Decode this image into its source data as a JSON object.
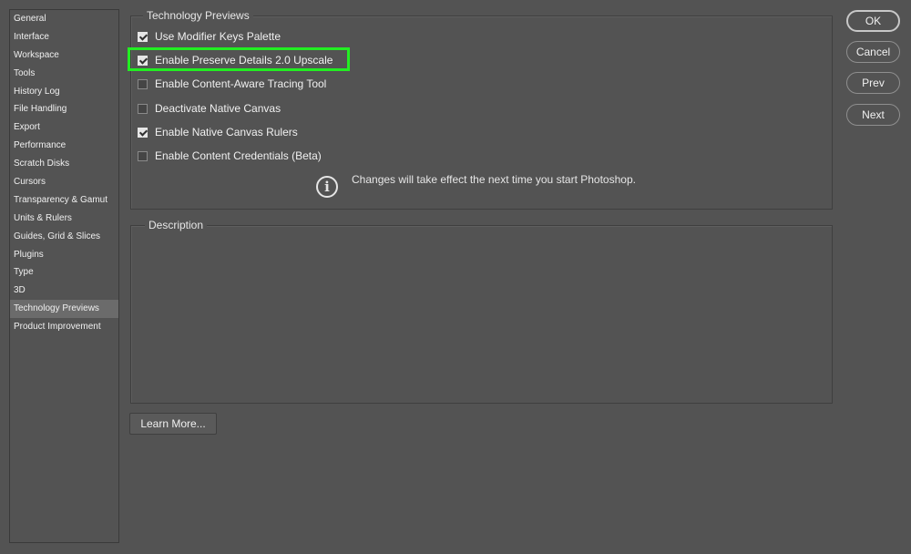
{
  "sidebar": {
    "items": [
      {
        "label": "General"
      },
      {
        "label": "Interface"
      },
      {
        "label": "Workspace"
      },
      {
        "label": "Tools"
      },
      {
        "label": "History Log"
      },
      {
        "label": "File Handling"
      },
      {
        "label": "Export"
      },
      {
        "label": "Performance"
      },
      {
        "label": "Scratch Disks"
      },
      {
        "label": "Cursors"
      },
      {
        "label": "Transparency & Gamut"
      },
      {
        "label": "Units & Rulers"
      },
      {
        "label": "Guides, Grid & Slices"
      },
      {
        "label": "Plugins"
      },
      {
        "label": "Type"
      },
      {
        "label": "3D"
      },
      {
        "label": "Technology Previews"
      },
      {
        "label": "Product Improvement"
      }
    ],
    "selected": "Technology Previews"
  },
  "tech_previews": {
    "title": "Technology Previews",
    "options": [
      {
        "label": "Use Modifier Keys Palette",
        "checked": true
      },
      {
        "label": "Enable Preserve Details 2.0 Upscale",
        "checked": true,
        "highlight_color": "#22ee22"
      },
      {
        "label": "Enable Content-Aware Tracing Tool",
        "checked": false
      },
      {
        "label": "Deactivate Native Canvas",
        "checked": false
      },
      {
        "label": "Enable Native Canvas Rulers",
        "checked": true
      },
      {
        "label": "Enable Content Credentials (Beta)",
        "checked": false
      }
    ],
    "note_icon": "info-icon",
    "note": "Changes will take effect the next time you start Photoshop."
  },
  "description": {
    "title": "Description"
  },
  "buttons": {
    "ok": "OK",
    "cancel": "Cancel",
    "prev": "Prev",
    "next": "Next",
    "learn_more": "Learn More..."
  }
}
